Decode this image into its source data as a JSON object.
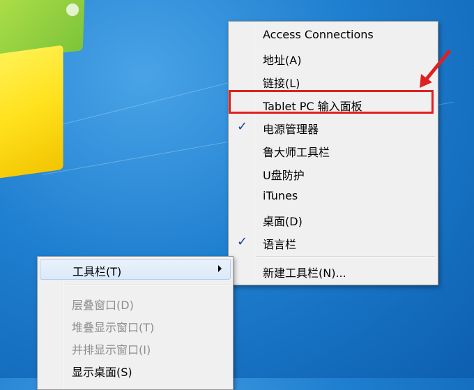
{
  "submenu": {
    "items": [
      {
        "label": "Access Connections",
        "checked": false
      },
      {
        "label": "地址(A)",
        "checked": false
      },
      {
        "label": "链接(L)",
        "checked": false
      },
      {
        "label": "Tablet PC 输入面板",
        "checked": false,
        "highlighted": true
      },
      {
        "label": "电源管理器",
        "checked": true
      },
      {
        "label": "鲁大师工具栏",
        "checked": false
      },
      {
        "label": "U盘防护",
        "checked": false
      },
      {
        "label": "iTunes",
        "checked": false
      },
      {
        "label": "桌面(D)",
        "checked": false
      },
      {
        "label": "语言栏",
        "checked": true
      }
    ],
    "new_toolbar_label": "新建工具栏(N)...",
    "check_glyph": "✓"
  },
  "taskbar_menu": {
    "toolbars_label": "工具栏(T)",
    "items": [
      {
        "label": "层叠窗口(D)",
        "disabled": true
      },
      {
        "label": "堆叠显示窗口(T)",
        "disabled": true
      },
      {
        "label": "并排显示窗口(I)",
        "disabled": true
      },
      {
        "label": "显示桌面(S)",
        "disabled": false
      }
    ]
  },
  "annotation": {
    "color": "#e02020"
  }
}
